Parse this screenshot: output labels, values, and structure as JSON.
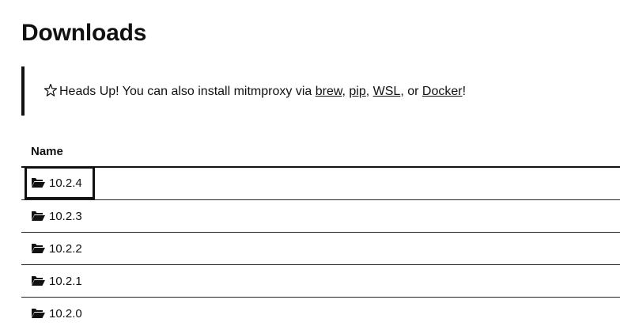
{
  "page": {
    "title": "Downloads"
  },
  "callout": {
    "icon": "star-icon",
    "prefix": "Heads Up! You can also install mitmproxy via ",
    "links": [
      "brew",
      "pip",
      "WSL",
      "Docker"
    ],
    "sep1": ", ",
    "sep2": ", ",
    "sep3": ", or ",
    "suffix": "!"
  },
  "table": {
    "header": "Name",
    "rows": [
      {
        "label": "10.2.4",
        "icon": "folder-open-icon"
      },
      {
        "label": "10.2.3",
        "icon": "folder-open-icon"
      },
      {
        "label": "10.2.2",
        "icon": "folder-open-icon"
      },
      {
        "label": "10.2.1",
        "icon": "folder-open-icon"
      },
      {
        "label": "10.2.0",
        "icon": "folder-open-icon"
      }
    ]
  },
  "colors": {
    "text": "#111111",
    "background": "#ffffff"
  }
}
